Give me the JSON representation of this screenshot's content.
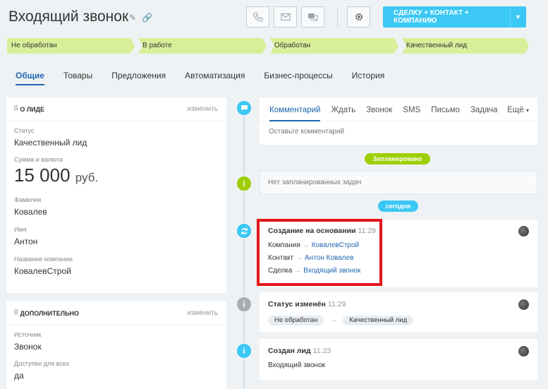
{
  "header": {
    "title": "Входящий звонок",
    "cta_label": "СДЕЛКУ + КОНТАКТ + КОМПАНИЮ",
    "accent": "#3bc8f5"
  },
  "stages": [
    "Не обработан",
    "В работе",
    "Обработан",
    "Качественный лид"
  ],
  "tabs": [
    "Общие",
    "Товары",
    "Предложения",
    "Автоматизация",
    "Бизнес-процессы",
    "История"
  ],
  "about": {
    "heading": "О ЛИДЕ",
    "edit": "изменить",
    "status_label": "Статус",
    "status_value": "Качественный лид",
    "amount_label": "Сумма и валюта",
    "amount_value": "15 000",
    "amount_currency": "руб.",
    "lastname_label": "Фамилия",
    "lastname_value": "Ковалев",
    "name_label": "Имя",
    "name_value": "Антон",
    "company_label": "Название компании",
    "company_value": "КовалевСтрой"
  },
  "extra": {
    "heading": "ДОПОЛНИТЕЛЬНО",
    "edit": "изменить",
    "source_label": "Источник",
    "source_value": "Звонок",
    "available_label": "Доступен для всех",
    "available_value": "да"
  },
  "composer": {
    "tabs": [
      "Комментарий",
      "Ждать",
      "Звонок",
      "SMS",
      "Письмо",
      "Задача"
    ],
    "more": "Ещё",
    "placeholder": "Оставьте комментарий"
  },
  "planned": {
    "badge": "Запланировано",
    "empty": "Нет запланированных задач"
  },
  "today_badge": "сегодня",
  "events": {
    "created_from": {
      "title": "Создание на основании",
      "time": "11:29",
      "company_label": "Компания",
      "company_link": "КовалевСтрой",
      "contact_label": "Контакт",
      "contact_link": "Антон Ковалев",
      "deal_label": "Сделка",
      "deal_link": "Входящий звонок"
    },
    "status_changed": {
      "title": "Статус изменён",
      "time": "11:29",
      "from": "Не обработан",
      "to": "Качественный лид"
    },
    "lead_created": {
      "title": "Создан лид",
      "time": "11:23",
      "text": "Входящий звонок"
    }
  },
  "arrow": "→"
}
